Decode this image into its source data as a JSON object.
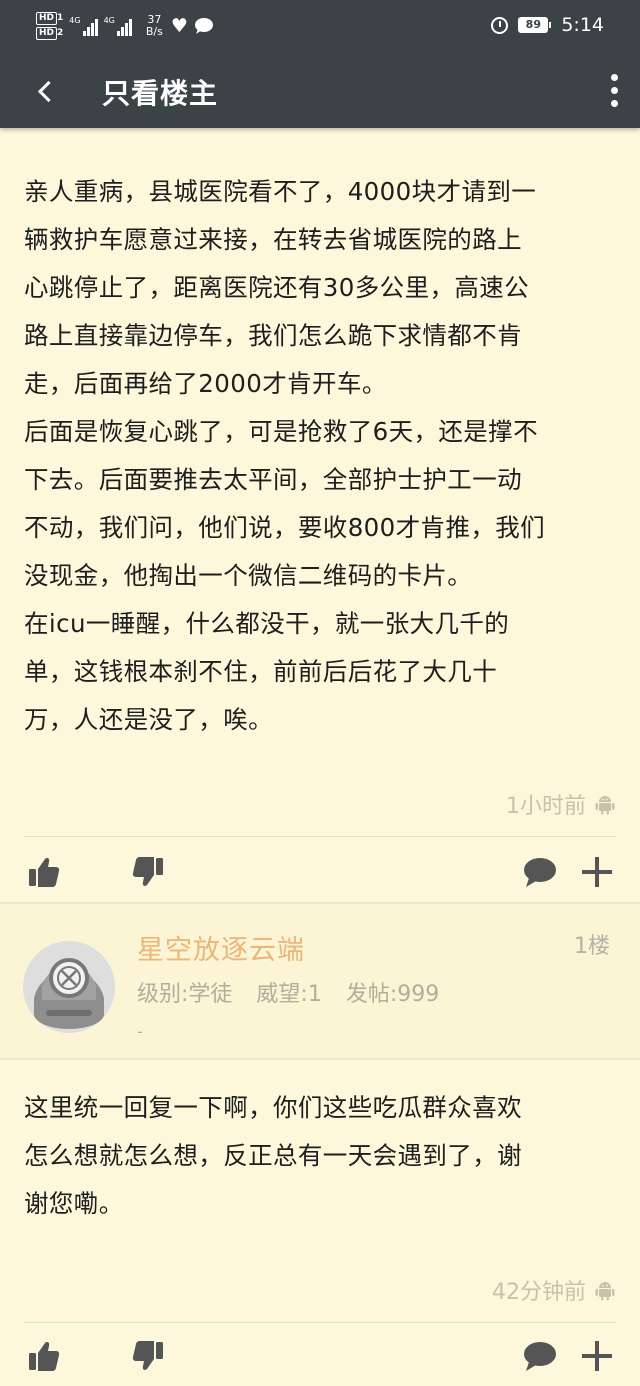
{
  "status_bar": {
    "hd1": "HD",
    "hd1_sub": "1",
    "hd2": "HD",
    "hd2_sub": "2",
    "net1": "4G",
    "net2": "4G",
    "speed_value": "37",
    "speed_unit": "B/s",
    "heart_icon": "heart-pulse-icon",
    "chat_icon": "chat-bubble-icon",
    "battery": "89",
    "time": "5:14"
  },
  "app_bar": {
    "title": "只看楼主",
    "back_icon": "chevron-left-icon",
    "more_icon": "more-vertical-icon"
  },
  "post": {
    "text": "亲人重病，县城医院看不了，4000块才请到一\n辆救护车愿意过来接，在转去省城医院的路上\n心跳停止了，距离医院还有30多公里，高速公\n路上直接靠边停车，我们怎么跪下求情都不肯\n走，后面再给了2000才肯开车。\n后面是恢复心跳了，可是抢救了6天，还是撑不\n下去。后面要推去太平间，全部护士护工一动\n不动，我们问，他们说，要收800才肯推，我们\n没现金，他掏出一个微信二维码的卡片。\n在icu一睡醒，什么都没干，就一张大几千的\n单，这钱根本刹不住，前前后后花了大几十\n万，人还是没了，唉。",
    "time": "1小时前",
    "device_icon": "android-icon"
  },
  "reply": {
    "username": "星空放逐云端",
    "floor": "1楼",
    "level": "级别:学徒",
    "reputation": "威望:1",
    "posts": "发帖:999",
    "signature": "-",
    "text": "这里统一回复一下啊，你们这些吃瓜群众喜欢\n怎么想就怎么想，反正总有一天会遇到了，谢\n谢您嘞。",
    "time": "42分钟前",
    "device_icon": "android-icon"
  },
  "actions": {
    "like_icon": "thumbs-up-icon",
    "dislike_icon": "thumbs-down-icon",
    "comment_icon": "comment-bubble-icon",
    "add_icon": "plus-icon"
  },
  "colors": {
    "bar": "#3c4347",
    "page_bg": "#fdf8dc",
    "username": "#ecb679",
    "icon": "#555555"
  }
}
